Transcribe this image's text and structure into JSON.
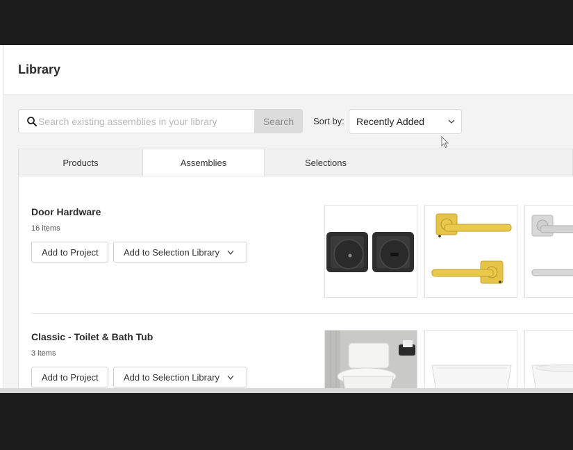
{
  "header": {
    "title": "Library"
  },
  "search": {
    "placeholder": "Search existing assemblies in your library",
    "button_label": "Search"
  },
  "sort": {
    "label": "Sort by:",
    "selected": "Recently Added"
  },
  "tabs": [
    {
      "label": "Products",
      "active": false
    },
    {
      "label": "Assemblies",
      "active": true
    },
    {
      "label": "Selections",
      "active": false
    }
  ],
  "assemblies": [
    {
      "name": "Door Hardware",
      "count": "16 items",
      "add_project_label": "Add to Project",
      "add_selection_label": "Add to Selection Library",
      "thumbs": [
        "black-privacy-knobs",
        "brass-levers",
        "nickel-levers"
      ]
    },
    {
      "name": "Classic - Toilet & Bath Tub",
      "count": "3 items",
      "add_project_label": "Add to Project",
      "add_selection_label": "Add to Selection Library",
      "thumbs": [
        "toilet-photo",
        "bathtub",
        "bathtub"
      ]
    }
  ],
  "colors": {
    "accent_gold": "#e9c94a",
    "panel_bg": "#ffffff",
    "app_bg": "#f3f3f3"
  }
}
